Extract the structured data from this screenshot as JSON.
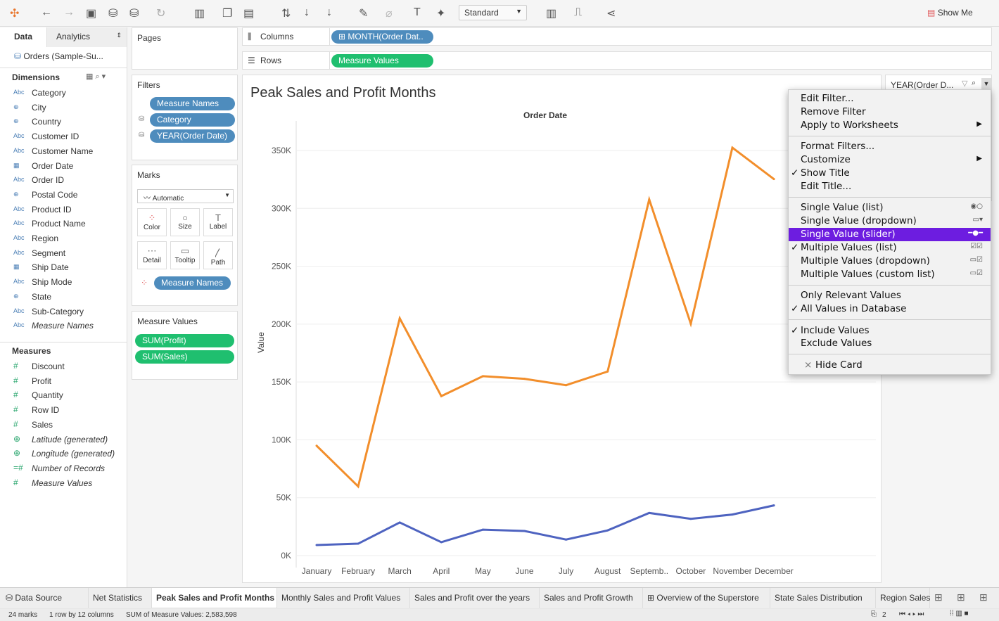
{
  "toolbar": {
    "view_size": "Standard",
    "show_me": "Show Me"
  },
  "left": {
    "tabs": [
      "Data",
      "Analytics"
    ],
    "datasource": "Orders (Sample-Su...",
    "dimensions_label": "Dimensions",
    "measures_label": "Measures",
    "dimensions": [
      {
        "label": "Category",
        "type": "Abc"
      },
      {
        "label": "City",
        "type": "geo"
      },
      {
        "label": "Country",
        "type": "geo"
      },
      {
        "label": "Customer ID",
        "type": "Abc"
      },
      {
        "label": "Customer Name",
        "type": "Abc"
      },
      {
        "label": "Order Date",
        "type": "date"
      },
      {
        "label": "Order ID",
        "type": "Abc"
      },
      {
        "label": "Postal Code",
        "type": "geo"
      },
      {
        "label": "Product ID",
        "type": "Abc"
      },
      {
        "label": "Product Name",
        "type": "Abc"
      },
      {
        "label": "Region",
        "type": "Abc"
      },
      {
        "label": "Segment",
        "type": "Abc"
      },
      {
        "label": "Ship Date",
        "type": "date"
      },
      {
        "label": "Ship Mode",
        "type": "Abc"
      },
      {
        "label": "State",
        "type": "geo"
      },
      {
        "label": "Sub-Category",
        "type": "Abc"
      },
      {
        "label": "Measure Names",
        "type": "Abc",
        "italic": true
      }
    ],
    "measures": [
      {
        "label": "Discount",
        "type": "#"
      },
      {
        "label": "Profit",
        "type": "#"
      },
      {
        "label": "Quantity",
        "type": "#"
      },
      {
        "label": "Row ID",
        "type": "#"
      },
      {
        "label": "Sales",
        "type": "#"
      },
      {
        "label": "Latitude (generated)",
        "type": "geo",
        "italic": true
      },
      {
        "label": "Longitude (generated)",
        "type": "geo",
        "italic": true
      },
      {
        "label": "Number of Records",
        "type": "=#",
        "italic": true
      },
      {
        "label": "Measure Values",
        "type": "#",
        "italic": true
      }
    ]
  },
  "shelves": {
    "pages": "Pages",
    "filters": "Filters",
    "filter_pills": [
      "Measure Names",
      "Category",
      "YEAR(Order Date)"
    ],
    "marks": "Marks",
    "mark_type": "Automatic",
    "mark_buttons": [
      "Color",
      "Size",
      "Label",
      "Detail",
      "Tooltip",
      "Path"
    ],
    "color_pill": "Measure Names",
    "measure_values": "Measure Values",
    "mv_pills": [
      "SUM(Profit)",
      "SUM(Sales)"
    ],
    "columns": "Columns",
    "columns_pill": "MONTH(Order Dat..",
    "rows": "Rows",
    "rows_pill": "Measure Values"
  },
  "filter_card": {
    "title": "YEAR(Order D..."
  },
  "menu": {
    "items": [
      {
        "label": "Edit Filter..."
      },
      {
        "label": "Remove Filter"
      },
      {
        "label": "Apply to Worksheets",
        "submenu": true
      },
      {
        "sep": true
      },
      {
        "label": "Format Filters..."
      },
      {
        "label": "Customize",
        "submenu": true
      },
      {
        "label": "Show Title",
        "checked": true
      },
      {
        "label": "Edit Title..."
      },
      {
        "sep": true
      },
      {
        "label": "Single Value (list)",
        "icon": "◉○"
      },
      {
        "label": "Single Value (dropdown)",
        "icon": "▭▾"
      },
      {
        "label": "Single Value (slider)",
        "icon": "━●━",
        "selected": true
      },
      {
        "label": "Multiple Values (list)",
        "checked": true,
        "icon": "☑☑"
      },
      {
        "label": "Multiple Values (dropdown)",
        "icon": "▭☑"
      },
      {
        "label": "Multiple Values (custom list)",
        "icon": "▭☑"
      },
      {
        "sep": true
      },
      {
        "label": "Only Relevant Values"
      },
      {
        "label": "All Values in Database",
        "checked": true
      },
      {
        "sep": true
      },
      {
        "label": "Include Values",
        "checked": true
      },
      {
        "label": "Exclude Values"
      },
      {
        "sep": true
      },
      {
        "label": "Hide Card",
        "x": true
      }
    ]
  },
  "chart_data": {
    "type": "line",
    "title": "Peak Sales and Profit Months",
    "xlabel": "Order Date",
    "ylabel": "Value",
    "categories": [
      "January",
      "February",
      "March",
      "April",
      "May",
      "June",
      "July",
      "August",
      "Septemb..",
      "October",
      "November",
      "December"
    ],
    "yticks": [
      "0K",
      "50K",
      "100K",
      "150K",
      "200K",
      "250K",
      "300K",
      "350K"
    ],
    "ylim": [
      0,
      370000
    ],
    "grid": true,
    "series": [
      {
        "measure": "Sales",
        "color": "#f28e2b",
        "values": [
          94925,
          59751,
          205005,
          137762,
          155029,
          152718,
          147238,
          159044,
          307650,
          200323,
          352461,
          325294
        ]
      },
      {
        "measure": "Profit",
        "color": "#4e63c0",
        "values": [
          9134,
          10295,
          28595,
          11588,
          22411,
          21285,
          13832,
          21776,
          36857,
          31785,
          35469,
          43369
        ]
      }
    ]
  },
  "tabs": [
    "Data Source",
    "Net Statistics",
    "Peak Sales and Profit Months",
    "Monthly Sales and Profit Values",
    "Sales and Profit over the years",
    "Sales and Profit Growth",
    "Overview of the Superstore",
    "State Sales Distribution",
    "Region Sales"
  ],
  "status": {
    "marks": "24 marks",
    "dims": "1 row by 12 columns",
    "sum": "SUM of Measure Values: 2,583,598",
    "page": "2"
  }
}
